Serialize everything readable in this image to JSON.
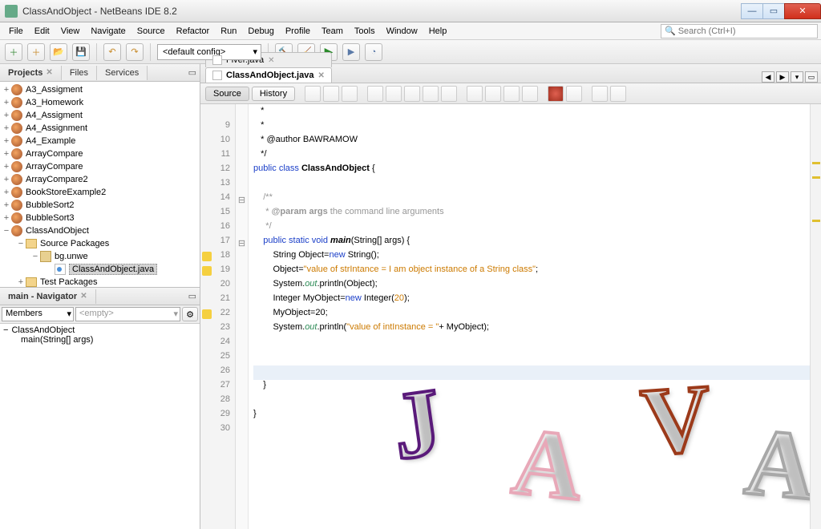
{
  "window": {
    "title": "ClassAndObject - NetBeans IDE 8.2"
  },
  "menu": [
    "File",
    "Edit",
    "View",
    "Navigate",
    "Source",
    "Refactor",
    "Run",
    "Debug",
    "Profile",
    "Team",
    "Tools",
    "Window",
    "Help"
  ],
  "search_placeholder": "Search (Ctrl+I)",
  "config_combo": "<default config>",
  "left_tabs": {
    "projects": "Projects",
    "files": "Files",
    "services": "Services"
  },
  "projects_tree": [
    {
      "name": "A3_Assigment",
      "depth": 0,
      "icon": "coffee",
      "exp": "+"
    },
    {
      "name": "A3_Homework",
      "depth": 0,
      "icon": "coffee",
      "exp": "+"
    },
    {
      "name": "A4_Assigment",
      "depth": 0,
      "icon": "coffee",
      "exp": "+"
    },
    {
      "name": "A4_Assignment",
      "depth": 0,
      "icon": "coffee",
      "exp": "+"
    },
    {
      "name": "A4_Example",
      "depth": 0,
      "icon": "coffee",
      "exp": "+"
    },
    {
      "name": "ArrayCompare",
      "depth": 0,
      "icon": "coffee",
      "exp": "+"
    },
    {
      "name": "ArrayCompare",
      "depth": 0,
      "icon": "coffee",
      "exp": "+"
    },
    {
      "name": "ArrayCompare2",
      "depth": 0,
      "icon": "coffee",
      "exp": "+"
    },
    {
      "name": "BookStoreExample2",
      "depth": 0,
      "icon": "coffee",
      "exp": "+"
    },
    {
      "name": "BubbleSort2",
      "depth": 0,
      "icon": "coffee",
      "exp": "+"
    },
    {
      "name": "BubbleSort3",
      "depth": 0,
      "icon": "coffee",
      "exp": "+"
    },
    {
      "name": "ClassAndObject",
      "depth": 0,
      "icon": "coffee",
      "exp": "−"
    },
    {
      "name": "Source Packages",
      "depth": 1,
      "icon": "folder",
      "exp": "−"
    },
    {
      "name": "bg.unwe",
      "depth": 2,
      "icon": "pkg",
      "exp": "−"
    },
    {
      "name": "ClassAndObject.java",
      "depth": 3,
      "icon": "java",
      "exp": "",
      "selected": true
    },
    {
      "name": "Test Packages",
      "depth": 1,
      "icon": "folder",
      "exp": "+"
    }
  ],
  "navigator": {
    "title": "main - Navigator",
    "members_combo": "Members",
    "filter_combo": "<empty>",
    "tree": [
      {
        "name": "ClassAndObject",
        "depth": 0,
        "icon": "class"
      },
      {
        "name": "main(String[] args)",
        "depth": 1,
        "icon": "method"
      }
    ]
  },
  "editor_tabs": [
    {
      "name": "Fiver.java",
      "active": false
    },
    {
      "name": "ClassAndObject.java",
      "active": true
    }
  ],
  "src_history": {
    "source": "Source",
    "history": "History"
  },
  "code_lines": [
    {
      "n": "",
      "html": "   *"
    },
    {
      "n": "9",
      "html": "   *"
    },
    {
      "n": "10",
      "html": "   * @author BAWRAMOW"
    },
    {
      "n": "11",
      "html": "   */"
    },
    {
      "n": "12",
      "html": "<span class='kw'>public</span> <span class='kw'>class</span> <span class='type'>ClassAndObject</span> {"
    },
    {
      "n": "13",
      "html": ""
    },
    {
      "n": "14",
      "html": "    <span class='comment'>/**</span>",
      "fold": "⊟"
    },
    {
      "n": "15",
      "html": "    <span class='comment'> * <span class='docparam'>@param</span> <b>args</b> the command line arguments</span>"
    },
    {
      "n": "16",
      "html": "    <span class='comment'> */</span>"
    },
    {
      "n": "17",
      "html": "    <span class='kw'>public</span> <span class='kw'>static</span> <span class='kw'>void</span> <b><i>main</i></b>(String[] args) {",
      "fold": "⊟"
    },
    {
      "n": "18",
      "html": "        String Object=<span class='kw'>new</span> String();",
      "warn": true
    },
    {
      "n": "19",
      "html": "        Object=<span class='str'>\"value of strIntance = I am object instance of a String class\"</span>;",
      "warn": true
    },
    {
      "n": "20",
      "html": "        System.<span class='field'>out</span>.println(Object);"
    },
    {
      "n": "21",
      "html": "        Integer MyObject=<span class='kw'>new</span> Integer(<span class='str'>20</span>);"
    },
    {
      "n": "22",
      "html": "        MyObject=20;",
      "warn": true
    },
    {
      "n": "23",
      "html": "        System.<span class='field'>out</span>.println(<span class='str'>\"value of intInstance = \"</span>+ MyObject);"
    },
    {
      "n": "24",
      "html": ""
    },
    {
      "n": "25",
      "html": ""
    },
    {
      "n": "26",
      "html": "",
      "hl": true
    },
    {
      "n": "27",
      "html": "    }"
    },
    {
      "n": "28",
      "html": ""
    },
    {
      "n": "29",
      "html": "}"
    },
    {
      "n": "30",
      "html": ""
    }
  ]
}
